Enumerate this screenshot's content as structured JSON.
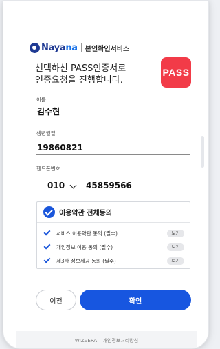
{
  "header": {
    "brand_prefix": "Naya",
    "brand_accent": "na",
    "service_name": "본인확인서비스"
  },
  "intro": {
    "line1": "선택하신 PASS인증서로",
    "line2": "인증요청을 진행합니다.",
    "pass_logo_text": "PASS"
  },
  "form": {
    "name_label": "이름",
    "name_value": "김수현",
    "birth_label": "생년월일",
    "birth_value": "19860821",
    "phone_label": "핸드폰번호",
    "carrier_value": "010",
    "phone_value": "45859566"
  },
  "agreements": {
    "all_label": "이용약관 전체동의",
    "items": [
      {
        "label": "서비스 이용약관 동의 (필수)",
        "view": "보기"
      },
      {
        "label": "개인정보 이용 동의 (필수)",
        "view": "보기"
      },
      {
        "label": "제3자 정보제공 동의 (필수)",
        "view": "보기"
      }
    ]
  },
  "buttons": {
    "prev": "이전",
    "confirm": "확인"
  },
  "footer": {
    "brand": "WIZVERA",
    "separator": "|",
    "privacy": "개인정보처리방침"
  },
  "colors": {
    "brand_navy": "#1f3a93",
    "primary_blue": "#1756e0",
    "pass_red": "#f23b48"
  }
}
